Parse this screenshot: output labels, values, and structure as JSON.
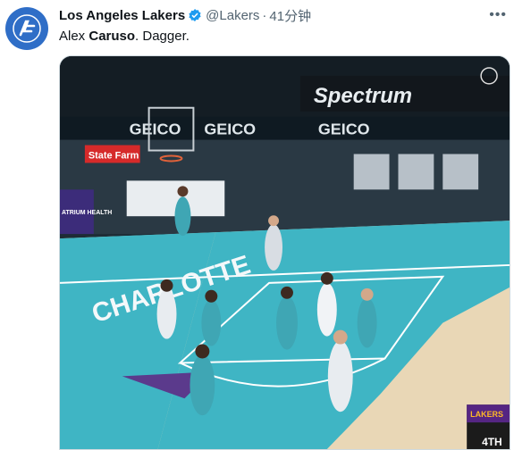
{
  "tweet": {
    "author_name": "Los Angeles Lakers",
    "handle": "@Lakers",
    "separator": "·",
    "time": "41分钟",
    "text_prefix": "Alex ",
    "text_bold": "Caruso",
    "text_suffix": ". Dagger."
  },
  "media": {
    "arena_sign": "Spectrum",
    "sponsor_1": "GEICO",
    "sponsor_2": "GEICO",
    "sponsor_3": "GEICO",
    "sponsor_4": "State Farm",
    "sponsor_5": "ATRIUM HEALTH",
    "court_text": "CHARLOTTE",
    "quarter": "4TH",
    "score_team": "LAKERS"
  },
  "colors": {
    "avatar_bg": "#2f6ec7",
    "verified": "#1d9bf0",
    "court_teal": "#3fb5c4",
    "court_wood": "#e9d7b6"
  }
}
